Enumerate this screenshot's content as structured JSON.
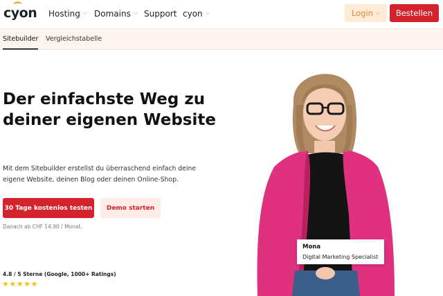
{
  "header": {
    "logo_text": "cyon",
    "nav": [
      {
        "label": "Hosting",
        "has_dropdown": true
      },
      {
        "label": "Domains",
        "has_dropdown": true
      },
      {
        "label": "Support",
        "has_dropdown": false
      },
      {
        "label": "cyon",
        "has_dropdown": true
      }
    ],
    "login_label": "Login",
    "order_label": "Bestellen"
  },
  "subnav": {
    "items": [
      {
        "label": "Sitebuilder",
        "active": true
      },
      {
        "label": "Vergleichstabelle",
        "active": false
      }
    ]
  },
  "hero": {
    "title": "Der einfachste Weg zu deiner eigenen Website",
    "subtitle": "Mit dem Sitebuilder erstellst du überraschend einfach deine eigene Website, deinen Blog oder deinen Online-Shop.",
    "primary_cta": "30 Tage kostenlos testen",
    "secondary_cta": "Demo starten",
    "price_note": "Danach ab CHF 14.90 / Monat.",
    "rating_text": "4.8 / 5 Sterne (Google, 1000+ Ratings)",
    "stars": "★★★★★"
  },
  "person": {
    "name": "Mona",
    "role": "Digital Marketing Specialist"
  },
  "colors": {
    "brand_red": "#d4232d",
    "login_bg": "#fdebd7",
    "login_text": "#e0892b",
    "subnav_bg": "#fdf3ef",
    "jacket_pink": "#e0317e",
    "star_gold": "#f4c20d"
  },
  "icons": {
    "dropdown": "chevron-down-icon",
    "rating": "star-icon"
  }
}
